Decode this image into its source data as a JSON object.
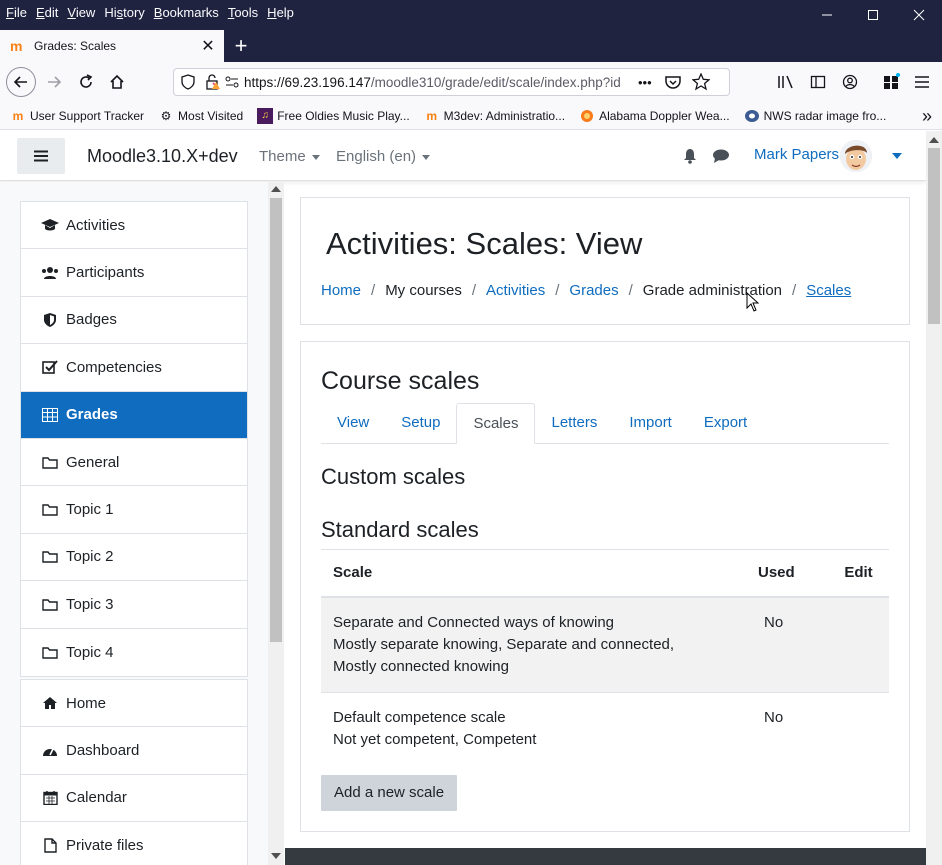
{
  "browser": {
    "menu": [
      "File",
      "Edit",
      "View",
      "History",
      "Bookmarks",
      "Tools",
      "Help"
    ],
    "menu_access_keys": [
      "F",
      "E",
      "V",
      "s",
      "B",
      "T",
      "H"
    ],
    "tab_title": "Grades: Scales",
    "url_host": "https://69.23.196.147",
    "url_path": "/moodle310/grade/edit/scale/index.php?id",
    "url_more": "•••",
    "bookmarks": [
      {
        "label": "User Support Tracker",
        "icon": "moodle-icon"
      },
      {
        "label": "Most Visited",
        "icon": "gear-icon"
      },
      {
        "label": "Free Oldies Music Play...",
        "icon": "radio-icon"
      },
      {
        "label": "M3dev: Administratio...",
        "icon": "moodle-icon"
      },
      {
        "label": "Alabama Doppler Wea...",
        "icon": "weather-icon"
      },
      {
        "label": "NWS radar image fro...",
        "icon": "nws-icon"
      }
    ]
  },
  "navbar": {
    "brand": "Moodle3.10.X+dev",
    "theme": "Theme",
    "language": "English (en)",
    "user_name": "Mark Papers"
  },
  "drawer": {
    "course_items": [
      {
        "label": "Activities",
        "icon": "graduation-cap-icon",
        "active": false
      },
      {
        "label": "Participants",
        "icon": "users-icon",
        "active": false
      },
      {
        "label": "Badges",
        "icon": "shield-icon",
        "active": false
      },
      {
        "label": "Competencies",
        "icon": "check-square-icon",
        "active": false
      },
      {
        "label": "Grades",
        "icon": "table-icon",
        "active": true
      },
      {
        "label": "General",
        "icon": "folder-icon",
        "active": false
      },
      {
        "label": "Topic 1",
        "icon": "folder-icon",
        "active": false
      },
      {
        "label": "Topic 2",
        "icon": "folder-icon",
        "active": false
      },
      {
        "label": "Topic 3",
        "icon": "folder-icon",
        "active": false
      },
      {
        "label": "Topic 4",
        "icon": "folder-icon",
        "active": false
      }
    ],
    "site_items": [
      {
        "label": "Home",
        "icon": "home-icon"
      },
      {
        "label": "Dashboard",
        "icon": "dashboard-icon"
      },
      {
        "label": "Calendar",
        "icon": "calendar-icon"
      },
      {
        "label": "Private files",
        "icon": "file-icon"
      }
    ]
  },
  "header": {
    "title": "Activities: Scales: View",
    "breadcrumb": [
      "Home",
      "My courses",
      "Activities",
      "Grades",
      "Grade administration",
      "Scales"
    ]
  },
  "main": {
    "heading": "Course scales",
    "tabs": [
      "View",
      "Setup",
      "Scales",
      "Letters",
      "Import",
      "Export"
    ],
    "active_tab": "Scales",
    "custom_heading": "Custom scales",
    "standard_heading": "Standard scales",
    "table": {
      "headers": [
        "Scale",
        "Used",
        "Edit"
      ],
      "rows": [
        {
          "name": "Separate and Connected ways of knowing",
          "items_line1": "Mostly separate knowing, Separate and connected,",
          "items_line2": "Mostly connected knowing",
          "used": "No",
          "edit": ""
        },
        {
          "name": "Default competence scale",
          "items_line1": "Not yet competent, Competent",
          "items_line2": "",
          "used": "No",
          "edit": ""
        }
      ]
    },
    "add_button": "Add a new scale"
  },
  "colors": {
    "brand_blue": "#0f6cbf",
    "firefox_dark": "#202340",
    "footer": "#343a40"
  }
}
